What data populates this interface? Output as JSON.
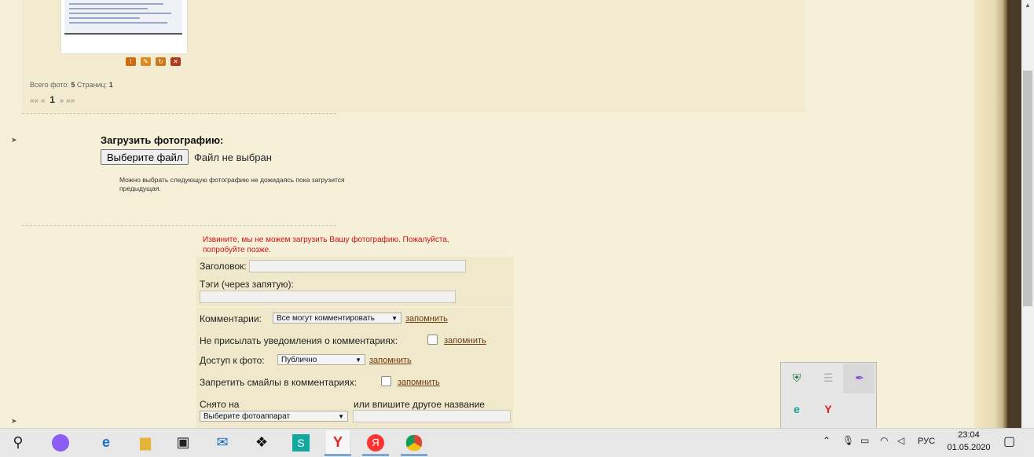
{
  "gallery": {
    "stats_label": "Всего фото:",
    "stats_count": "5",
    "pages_label": "Страниц:",
    "pages_count": "1",
    "pager_first": "«« «",
    "pager_current": "1",
    "pager_last": "» »»"
  },
  "upload": {
    "title": "Загрузить фотографию:",
    "choose_file_label": "Выберите файл",
    "file_status": "Файл не выбран",
    "hint": "Можно выбрать следующую фотографию не дожидаясь пока загрузится предыдущая."
  },
  "form": {
    "error": "Извините, мы не можем загрузить Вашу фотографию. Пожалуйста, попробуйте позже.",
    "title_label": "Заголовок:",
    "title_value": "",
    "tags_label": "Тэги (через запятую):",
    "tags_value": "",
    "comments_label": "Комментарии:",
    "comments_value": "Все могут комментировать",
    "no_notify_label": "Не присылать уведомления о комментариях:",
    "access_label": "Доступ к фото:",
    "access_value": "Публично",
    "no_smiles_label": "Запретить смайлы в комментариях:",
    "camera_label": "Снято на",
    "camera_value": "Выберите фотоаппарат",
    "other_name_label": "или впишите другое название",
    "remember": "запомнить"
  },
  "taskbar": {
    "language": "РУС",
    "time": "23:04",
    "date": "01.05.2020"
  },
  "colors": {
    "error": "#d01010",
    "link": "#6b3a10",
    "page_bg": "#f7f0d9"
  }
}
